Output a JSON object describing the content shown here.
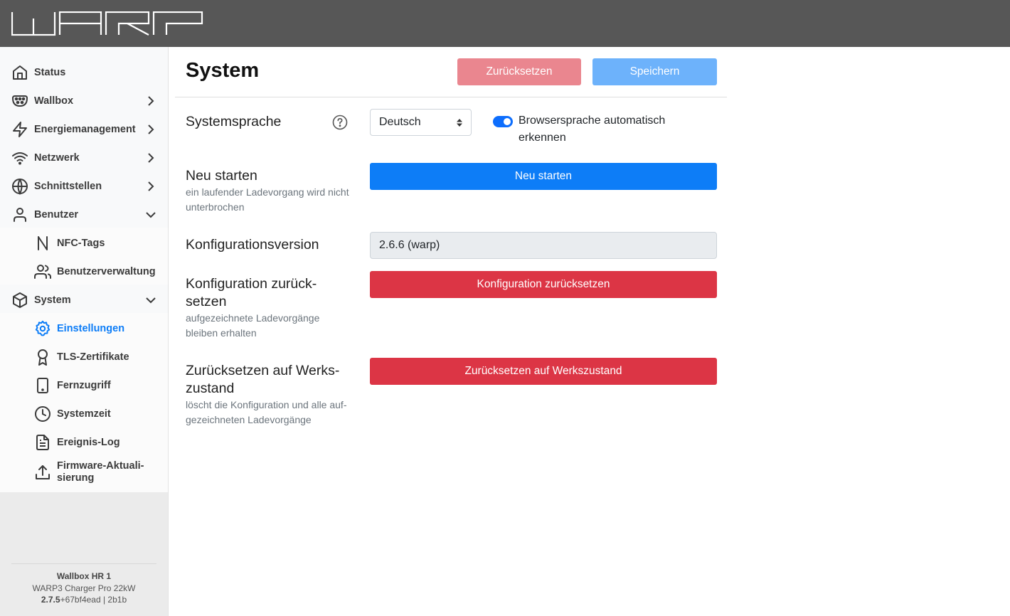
{
  "app": {
    "logo_text": "WARP"
  },
  "sidebar": {
    "items": [
      {
        "label": "Status",
        "icon": "home-icon"
      },
      {
        "label": "Wallbox",
        "icon": "charger-plug-icon"
      },
      {
        "label": "Energiemanagement",
        "icon": "lightning-icon"
      },
      {
        "label": "Netzwerk",
        "icon": "wifi-icon"
      },
      {
        "label": "Schnittstellen",
        "icon": "globe-icon"
      },
      {
        "label": "Benutzer",
        "icon": "user-icon"
      },
      {
        "label": "NFC-Tags",
        "icon": "nfc-icon"
      },
      {
        "label": "Benutzerverwaltung",
        "icon": "users-icon"
      },
      {
        "label": "System",
        "icon": "box-icon"
      },
      {
        "label": "Einstellungen",
        "icon": "gear-icon"
      },
      {
        "label": "TLS-Zertifikate",
        "icon": "award-icon"
      },
      {
        "label": "Fernzugriff",
        "icon": "tablet-icon"
      },
      {
        "label": "Systemzeit",
        "icon": "clock-icon"
      },
      {
        "label": "Ereignis-Log",
        "icon": "file-text-icon"
      },
      {
        "label": "Firmware-Aktuali-",
        "label2": "sierung",
        "icon": "upload-icon"
      }
    ],
    "footer": {
      "device_name": "Wallbox HR 1",
      "model": "WARP3 Charger Pro 22kW",
      "version_bold": "2.7.5",
      "version_rest": "+67bf4ead | 2b1b"
    }
  },
  "header": {
    "title": "System",
    "reset_label": "Zurücksetzen",
    "save_label": "Speichern"
  },
  "settings": {
    "language": {
      "label": "Systemsprache",
      "value": "Deutsch",
      "auto_detect_label": "Browsersprache automatisch erkennen",
      "auto_detect_enabled": true
    },
    "restart": {
      "label": "Neu starten",
      "hint": "ein laufender Ladevorgang wird nicht unterbrochen",
      "button": "Neu starten"
    },
    "config_version": {
      "label": "Konfigurationsversion",
      "value": "2.6.6 (warp)"
    },
    "config_reset": {
      "label_line1": "Konfiguration zurück-",
      "label_line2": "setzen",
      "hint": "aufgezeichnete Ladevorgänge bleiben erhalten",
      "button": "Konfiguration zurücksetzen"
    },
    "factory_reset": {
      "label_line1": "Zurücksetzen auf Werks-",
      "label_line2": "zustand",
      "hint": "löscht die Konfiguration und alle auf­gezeichneten Ladevorgänge",
      "button": "Zurücksetzen auf Werkszustand"
    }
  },
  "colors": {
    "topbar": "#575757",
    "active": "#0d7df7",
    "primary": "#0d7df7",
    "danger": "#dc3545"
  }
}
